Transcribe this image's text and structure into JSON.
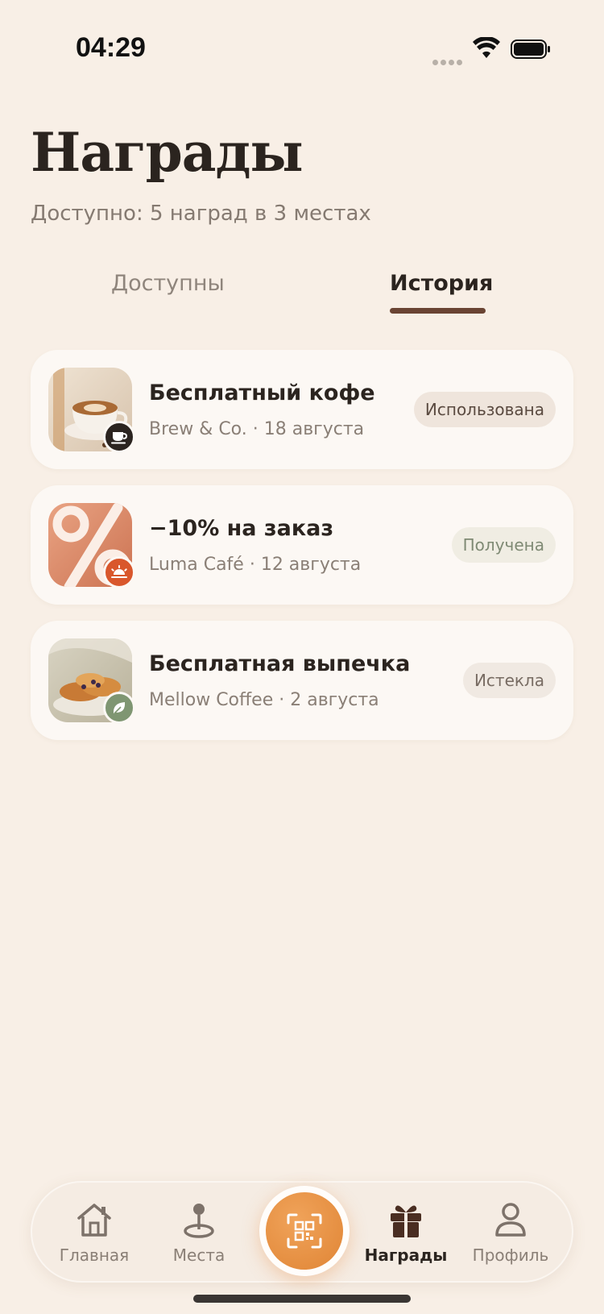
{
  "status_bar": {
    "time": "04:29"
  },
  "header": {
    "title": "Награды",
    "subtitle": "Доступно: 5 наград в 3 местах"
  },
  "tabs": [
    {
      "label": "Доступны",
      "active": false
    },
    {
      "label": "История",
      "active": true
    }
  ],
  "history": [
    {
      "title": "Бесплатный кофе",
      "meta": "Brew & Co. · 18 августа",
      "status": "Использована",
      "badge_icon": "coffee-cup-icon",
      "badge_color": "#2b2420"
    },
    {
      "title": "−10% на заказ",
      "meta": "Luma Café · 12 августа",
      "status": "Получена",
      "badge_icon": "sunrise-icon",
      "badge_color": "#d9572c"
    },
    {
      "title": "Бесплатная выпечка",
      "meta": "Mellow Coffee · 2 августа",
      "status": "Истекла",
      "badge_icon": "leaf-icon",
      "badge_color": "#7f9672"
    }
  ],
  "bottom_nav": {
    "home": "Главная",
    "places": "Места",
    "rewards": "Награды",
    "profile": "Профиль",
    "active": "rewards"
  },
  "colors": {
    "background": "#f8efe6",
    "accent": "#e8893a",
    "tab_underline": "#6a4433"
  }
}
